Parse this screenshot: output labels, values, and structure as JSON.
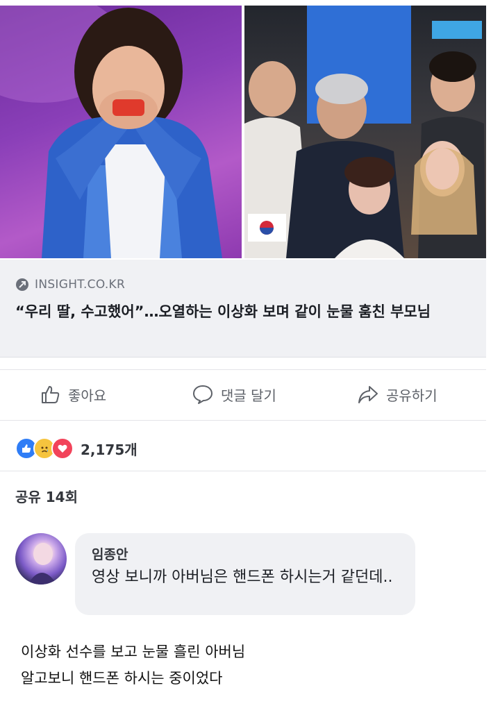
{
  "link_preview": {
    "source": "INSIGHT.CO.KR",
    "headline": "“우리 딸, 수고했어”…오열하는 이상화 보며 같이 눈물 훔친 부모님"
  },
  "actions": {
    "like": "좋아요",
    "comment": "댓글 달기",
    "share": "공유하기"
  },
  "reactions": {
    "icons": [
      "like-icon",
      "sad-icon",
      "love-icon"
    ],
    "count": "2,175개"
  },
  "shares": "공유 14회",
  "comment": {
    "author": "임종안",
    "text": "영상 보니까 아버님은 핸드폰 하시는거 같던데.."
  },
  "caption": {
    "line1": "이상화 선수를 보고 눈물 흘린 아버님",
    "line2": "알고보니 핸드폰 하시는 중이었다"
  },
  "colors": {
    "card_bg": "#f0f1f4",
    "like": "#2f7df6",
    "love": "#f2435a",
    "sad": "#f6c43e"
  }
}
